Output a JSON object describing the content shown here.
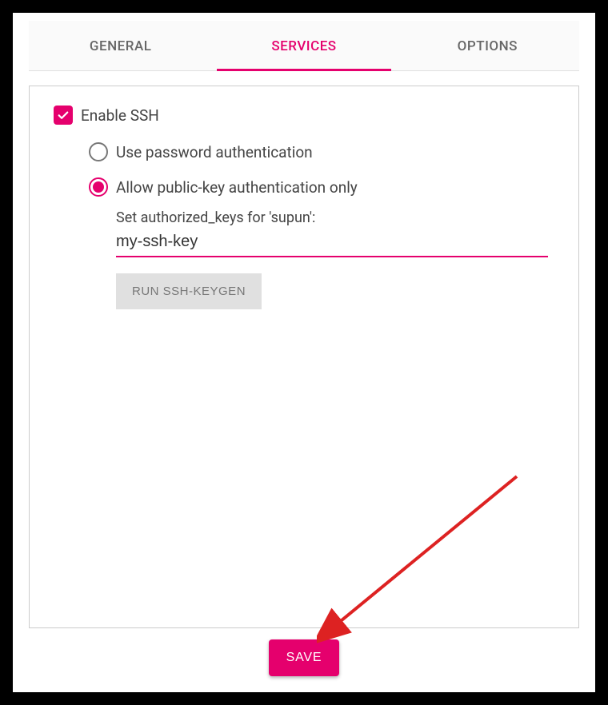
{
  "tabs": {
    "general": "GENERAL",
    "services": "SERVICES",
    "options": "OPTIONS",
    "active": "services"
  },
  "ssh": {
    "enable_label": "Enable SSH",
    "enabled": true,
    "auth_mode": "pubkey",
    "password_label": "Use password authentication",
    "pubkey_label": "Allow public-key authentication only",
    "authkeys_label": "Set authorized_keys for 'supun':",
    "authkeys_value": "my-ssh-key",
    "keygen_label": "RUN SSH-KEYGEN"
  },
  "actions": {
    "save_label": "SAVE"
  },
  "colors": {
    "accent": "#e5006d"
  }
}
